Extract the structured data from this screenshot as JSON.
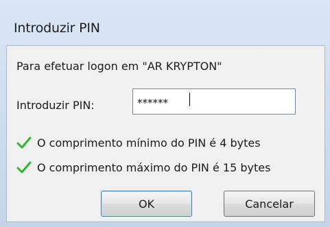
{
  "dialog": {
    "title": "Introduzir PIN",
    "message": "Para efetuar logon em \"AR KRYPTON\"",
    "pin_label": "Introduzir PIN:",
    "pin_value": "******",
    "requirements": [
      "O comprimento mínimo do PIN é 4 bytes",
      "O comprimento máximo do PIN é 15 bytes"
    ],
    "ok_label": "OK",
    "cancel_label": "Cancelar"
  },
  "icons": {
    "requirement_met": "checkmark-icon"
  },
  "colors": {
    "check_green": "#2fb52f",
    "accent_border": "#3c7fb1"
  }
}
